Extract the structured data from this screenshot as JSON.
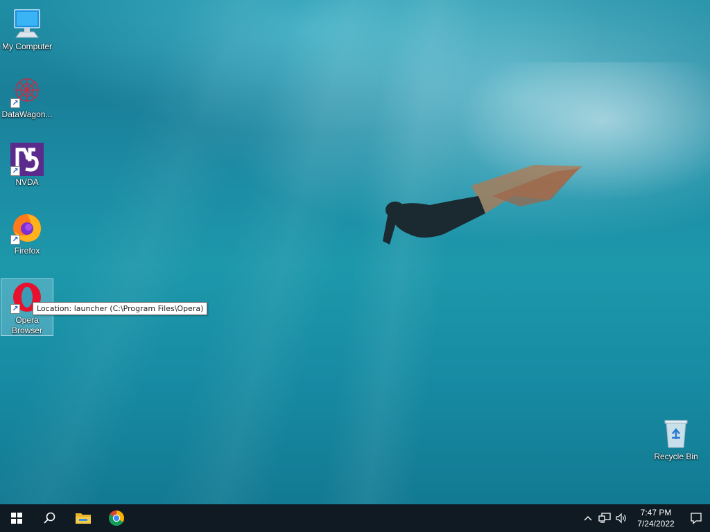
{
  "desktop": {
    "icons": [
      {
        "label": "My Computer"
      },
      {
        "label": "DataWagon..."
      },
      {
        "label": "NVDA"
      },
      {
        "label": "Firefox"
      },
      {
        "label": "Opera Browser"
      },
      {
        "label": "Recycle Bin"
      }
    ],
    "tooltip": "Location: launcher (C:\\Program Files\\Opera)"
  },
  "taskbar": {
    "clock_time": "7:47 PM",
    "clock_date": "7/24/2022",
    "icons": [
      "windows-start-icon",
      "search-icon",
      "file-explorer-icon",
      "chrome-icon"
    ],
    "tray_icons": [
      "chevron-up-icon",
      "network-icon",
      "volume-icon"
    ],
    "accent": "#0f1a23"
  }
}
